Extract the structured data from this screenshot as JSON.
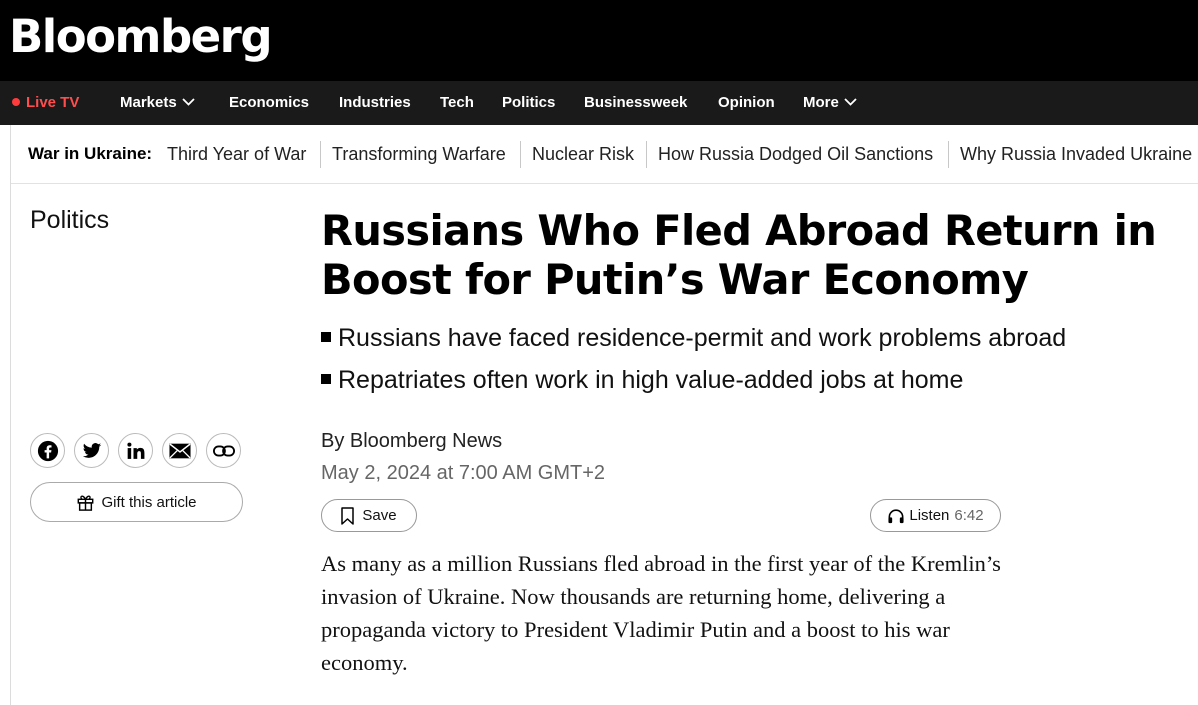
{
  "masthead": {
    "logo_text": "Bloomberg"
  },
  "nav": {
    "live_label": "Live TV",
    "items": [
      {
        "label": "Markets",
        "dropdown": true
      },
      {
        "label": "Economics"
      },
      {
        "label": "Industries"
      },
      {
        "label": "Tech"
      },
      {
        "label": "Politics"
      },
      {
        "label": "Businessweek"
      },
      {
        "label": "Opinion"
      },
      {
        "label": "More",
        "dropdown": true
      }
    ]
  },
  "subnav": {
    "label": "War in Ukraine:",
    "links": [
      "Third Year of War",
      "Transforming Warfare",
      "Nuclear Risk",
      "How Russia Dodged Oil Sanctions",
      "Why Russia Invaded Ukraine"
    ]
  },
  "article": {
    "section": "Politics",
    "headline": "Russians Who Fled Abroad Return in Boost for Putin’s War Economy",
    "bullets": [
      "Russians have faced residence-permit and work problems abroad",
      "Repatriates often work in high value-added jobs at home"
    ],
    "byline": "By Bloomberg News",
    "date": "May 2, 2024 at 7:00 AM GMT+2",
    "save_label": "Save",
    "listen_label": "Listen",
    "listen_duration": "6:42",
    "body": "As many as a million Russians fled abroad in the first year of the Kremlin’s invasion of Ukraine. Now thousands are returning home, delivering a propaganda victory to President Vladimir Putin and a boost to his war economy."
  },
  "share": {
    "icons": [
      "facebook-icon",
      "twitter-icon",
      "linkedin-icon",
      "email-icon",
      "link-icon"
    ],
    "gift_label": "Gift this article"
  },
  "colors": {
    "live_red": "#ff3b3b",
    "masthead_bg": "#000000",
    "nav_bg": "#1a1a1a"
  }
}
